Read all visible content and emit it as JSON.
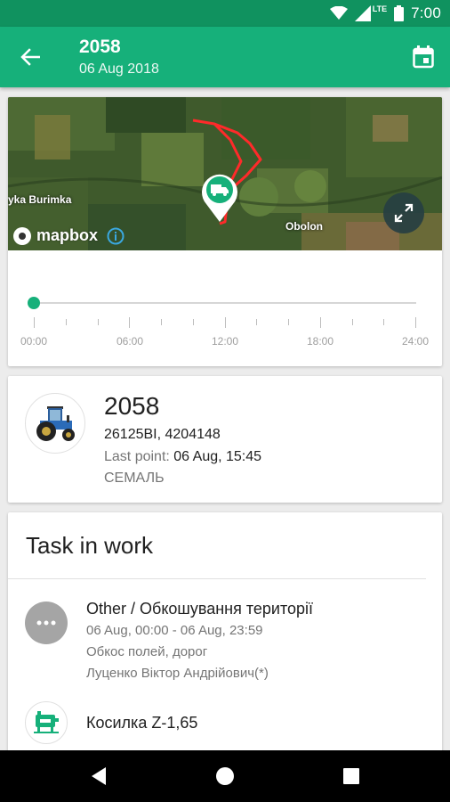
{
  "status_bar": {
    "time": "7:00",
    "network": "LTE"
  },
  "app_bar": {
    "title": "2058",
    "subtitle": "06 Aug 2018"
  },
  "map": {
    "labels": {
      "left": "yka Burimka",
      "right": "Obolon"
    },
    "attribution": "mapbox"
  },
  "timeline": {
    "labels": [
      "00:00",
      "06:00",
      "12:00",
      "18:00",
      "24:00"
    ],
    "position": 0
  },
  "vehicle": {
    "name": "2058",
    "plate": "26125ВІ, 4204148",
    "last_point_label": "Last point:",
    "last_point_value": "06 Aug, 15:45",
    "organization": "СЕМАЛЬ"
  },
  "task": {
    "heading": "Task in work",
    "title": "Other / Обкошування території",
    "period": "06 Aug, 00:00 - 06 Aug, 23:59",
    "description": "Обкос полей, дорог",
    "person": "Луценко Віктор Андрійович(*)",
    "equipment": "Косилка Z-1,65"
  },
  "colors": {
    "primary": "#16b07a",
    "primary_dark": "#10925f",
    "track": "#ff2a2a"
  }
}
